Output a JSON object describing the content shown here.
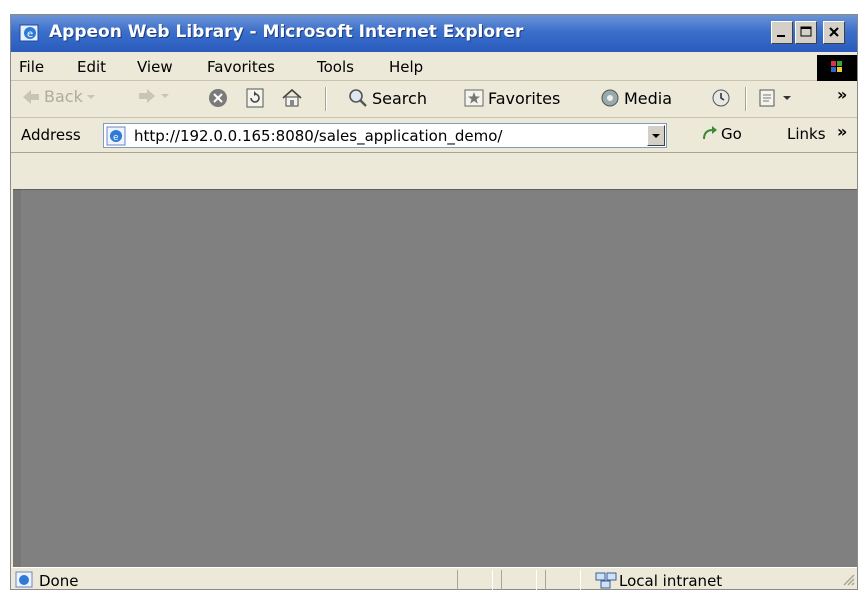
{
  "window": {
    "title": "Appeon Web Library - Microsoft Internet Explorer",
    "controls": {
      "minimize": "_",
      "maximize": "□",
      "close": "x"
    }
  },
  "menu": {
    "items": [
      "File",
      "Edit",
      "View",
      "Favorites",
      "Tools",
      "Help"
    ]
  },
  "toolbar": {
    "back_label": "Back",
    "search_label": "Search",
    "favorites_label": "Favorites",
    "media_label": "Media",
    "overflow": "»"
  },
  "address": {
    "label": "Address",
    "url": "http://192.0.0.165:8080/sales_application_demo/",
    "go_label": "Go",
    "links_label": "Links",
    "links_overflow": "»"
  },
  "status": {
    "text": "Done",
    "zone": "Local intranet"
  }
}
